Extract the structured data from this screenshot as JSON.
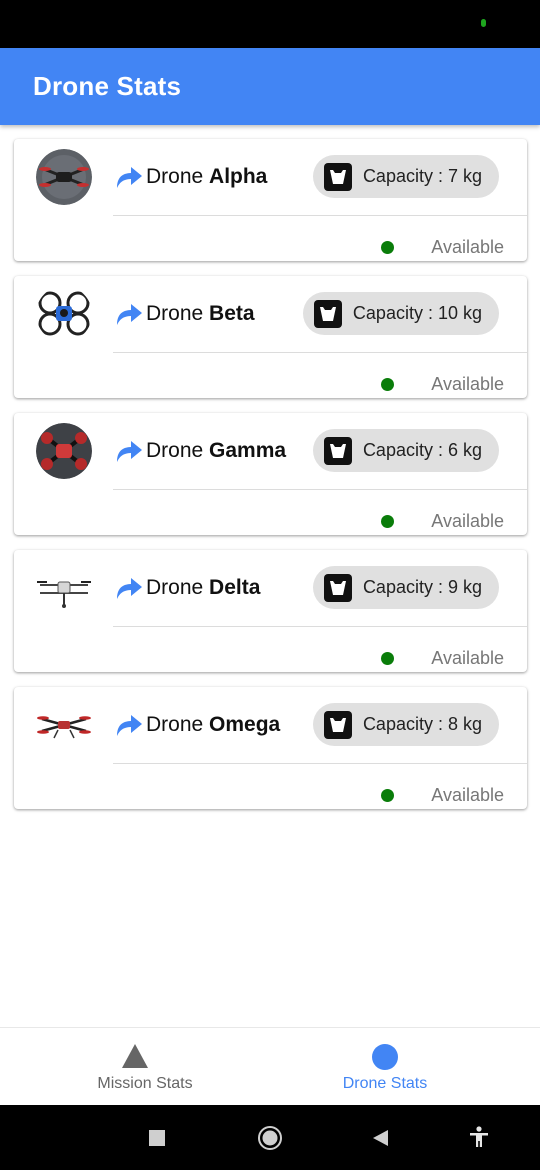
{
  "app": {
    "title": "Drone Stats"
  },
  "drones": [
    {
      "name_prefix": "Drone",
      "name": "Alpha",
      "capacity_label": "Capacity : 7 kg",
      "status": "Available"
    },
    {
      "name_prefix": "Drone",
      "name": "Beta",
      "capacity_label": "Capacity : 10 kg",
      "status": "Available"
    },
    {
      "name_prefix": "Drone",
      "name": "Gamma",
      "capacity_label": "Capacity : 6 kg",
      "status": "Available"
    },
    {
      "name_prefix": "Drone",
      "name": "Delta",
      "capacity_label": "Capacity : 9 kg",
      "status": "Available"
    },
    {
      "name_prefix": "Drone",
      "name": "Omega",
      "capacity_label": "Capacity : 8 kg",
      "status": "Available"
    }
  ],
  "bottom_nav": {
    "items": [
      {
        "label": "Mission Stats",
        "icon": "triangle-icon",
        "active": false
      },
      {
        "label": "Drone Stats",
        "icon": "circle-icon",
        "active": true
      }
    ]
  },
  "colors": {
    "accent": "#4285f4",
    "available": "#0a7d0a",
    "chip_bg": "#e0e0e0"
  },
  "icons": {
    "forward": "forward-arrow-icon",
    "capacity": "weight-icon",
    "status": "status-dot-icon"
  }
}
